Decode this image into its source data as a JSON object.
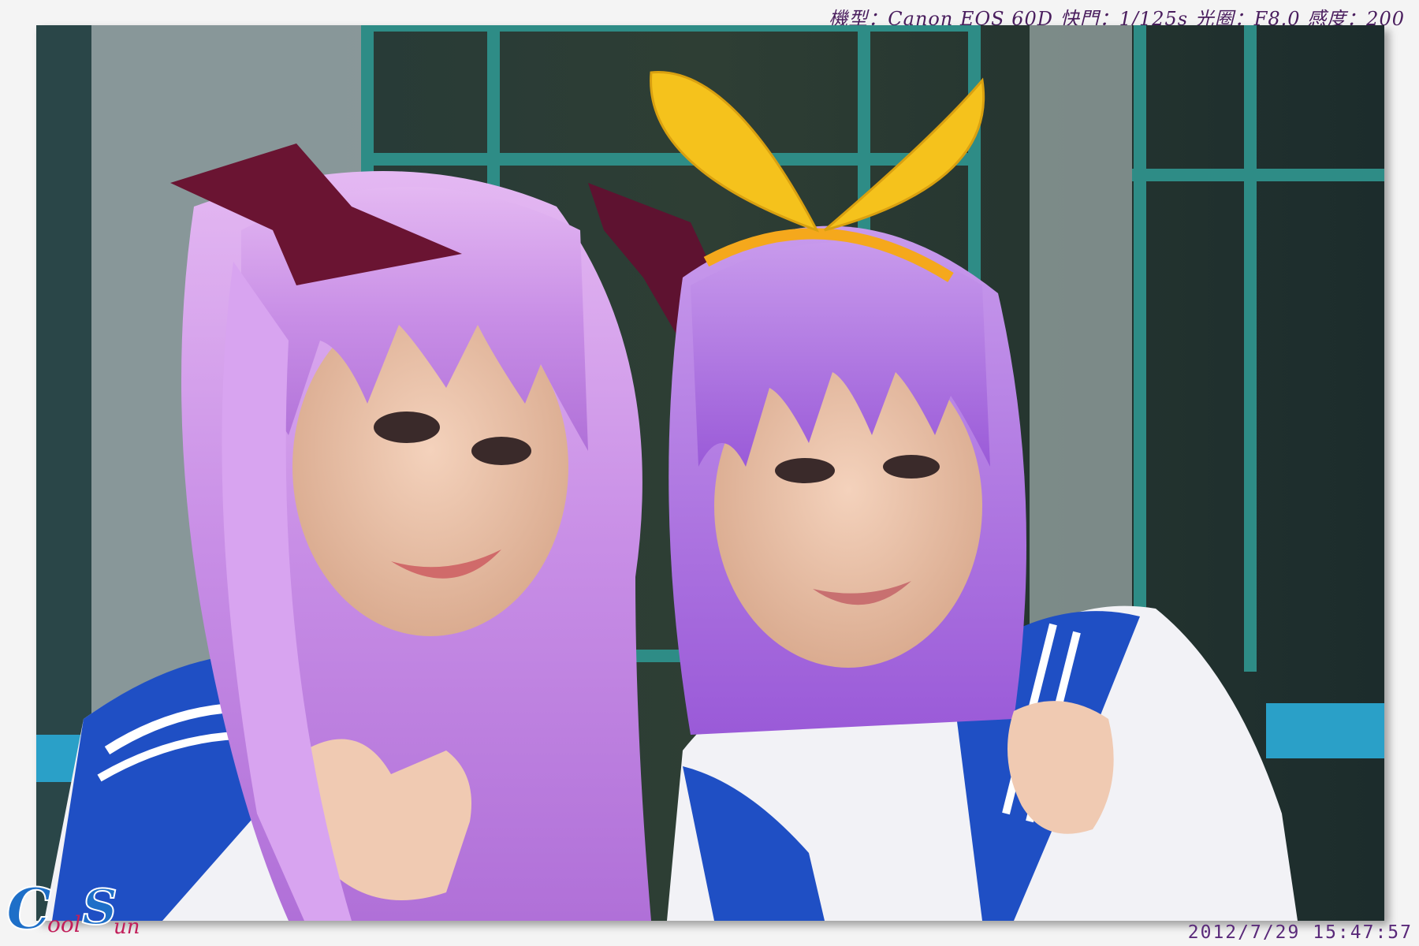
{
  "exif": {
    "text": "機型：Canon EOS 60D 快門：1/125s 光圈：F8.0 感度：200"
  },
  "datestamp": {
    "text": "2012/7/29  15:47:57"
  },
  "watermark": {
    "text": "CoolSun"
  },
  "colors": {
    "wig": "#c88ee6",
    "bow": "#6a1432",
    "headband": "#f5c21c",
    "collar": "#1f4fc4",
    "window_frame": "#2e8c86",
    "railing": "#2aa0c8"
  }
}
